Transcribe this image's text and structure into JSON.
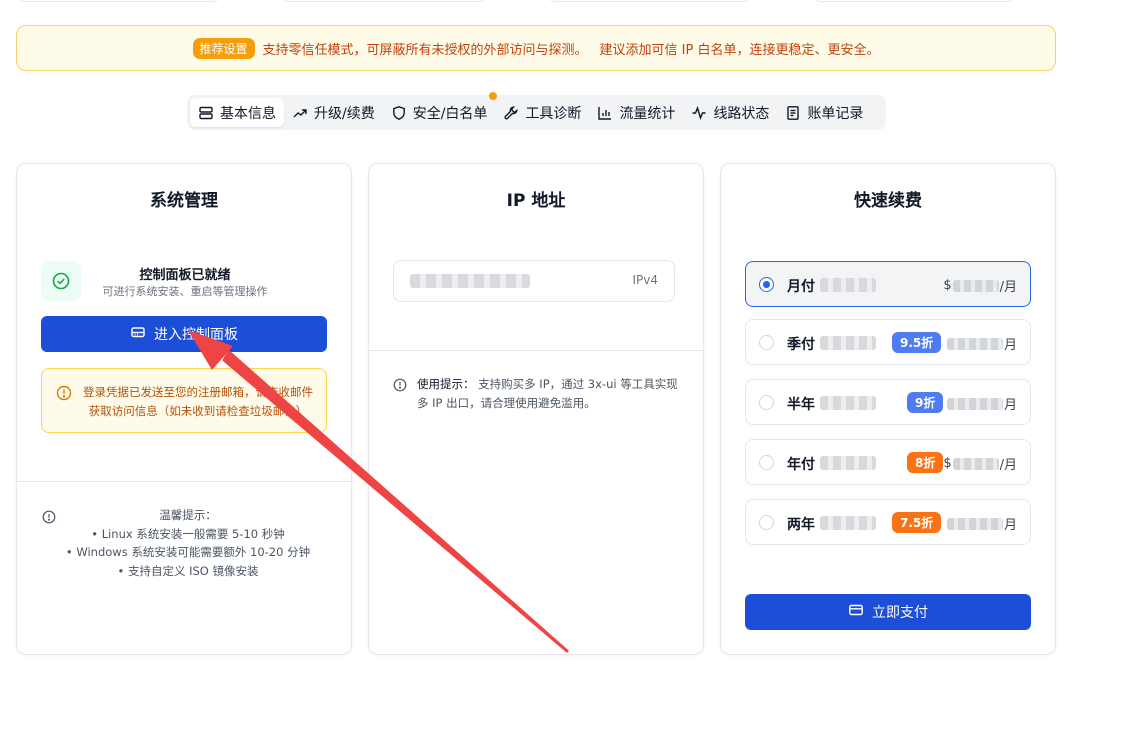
{
  "banner": {
    "badge": "推荐设置",
    "text": "支持零信任模式，可屏蔽所有未授权的外部访问与探测。",
    "text2": "建议添加可信 IP 白名单，连接更稳定、更安全。"
  },
  "tabs": [
    {
      "label": "基本信息",
      "icon": "server-icon"
    },
    {
      "label": "升级/续费",
      "icon": "trend-up-icon"
    },
    {
      "label": "安全/白名单",
      "icon": "shield-icon"
    },
    {
      "label": "工具诊断",
      "icon": "wrench-icon"
    },
    {
      "label": "流量统计",
      "icon": "bar-chart-icon"
    },
    {
      "label": "线路状态",
      "icon": "activity-icon"
    },
    {
      "label": "账单记录",
      "icon": "receipt-icon"
    }
  ],
  "system": {
    "title": "系统管理",
    "status_title": "控制面板已就绪",
    "status_sub": "可进行系统安装、重启等管理操作",
    "enter_button": "进入控制面板",
    "warning": "登录凭据已发送至您的注册邮箱，请查收邮件获取访问信息（如未收到请检查垃圾邮件）",
    "tips_title": "温馨提示：",
    "tips": [
      "• Linux 系统安装一般需要 5-10 秒钟",
      "• Windows 系统安装可能需要额外 10-20 分钟",
      "• 支持自定义 ISO 镜像安装"
    ]
  },
  "ip": {
    "title": "IP 地址",
    "version": "IPv4",
    "tip_lead": "使用提示：",
    "tip": "支持购买多 IP，通过 3x-ui 等工具实现多 IP 出口，请合理使用避免滥用。"
  },
  "renew": {
    "title": "快速续费",
    "plans": [
      {
        "name": "月付",
        "discount": "",
        "currency": "$",
        "unit": "/月",
        "selected": true
      },
      {
        "name": "季付",
        "discount": "9.5折",
        "discount_color": "#4f7cf0",
        "currency": "",
        "unit": "月",
        "selected": false
      },
      {
        "name": "半年",
        "discount": "9折",
        "discount_color": "#4f7cf0",
        "currency": "",
        "unit": "月",
        "selected": false
      },
      {
        "name": "年付",
        "discount": "8折",
        "discount_color": "#f97316",
        "currency": "$",
        "unit": "/月",
        "selected": false
      },
      {
        "name": "两年",
        "discount": "7.5折",
        "discount_color": "#f97316",
        "currency": "",
        "unit": "月",
        "selected": false
      }
    ],
    "pay_button": "立即支付"
  },
  "colors": {
    "primary": "#1d4ed8",
    "warning_text": "#b45309",
    "banner_text": "#c2410c",
    "annotation_arrow": "#ef4444"
  }
}
